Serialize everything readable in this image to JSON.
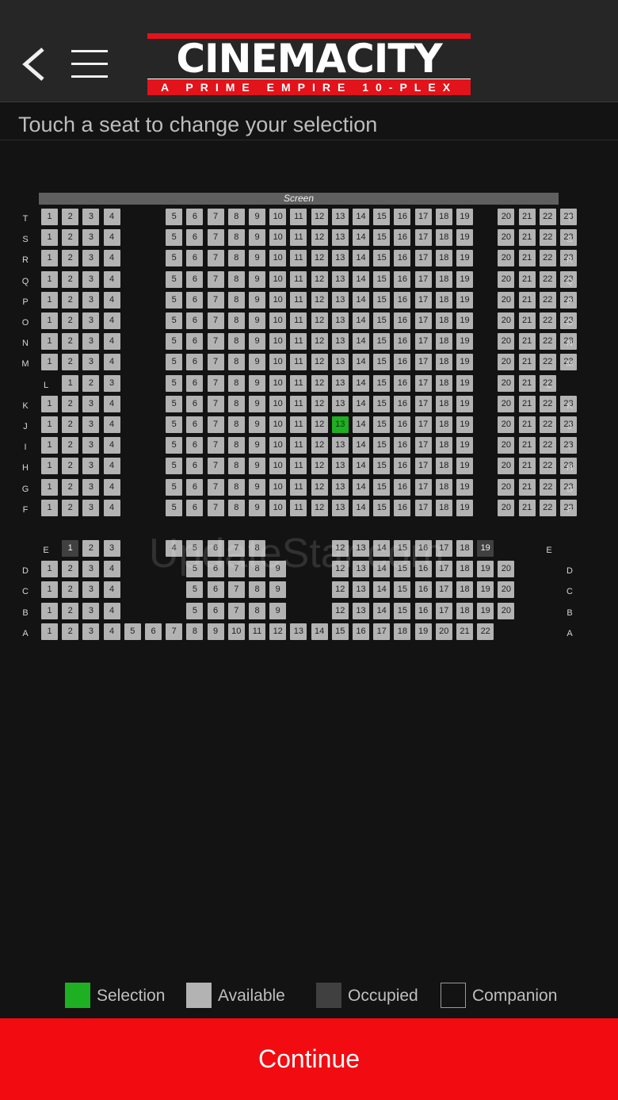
{
  "header": {
    "brand_name": "CINEMACITY",
    "brand_tagline": "A PRIME EMPIRE 10-PLEX"
  },
  "instruction": "Touch a seat to change your selection",
  "screen_label": "Screen",
  "watermark": "UpdateStar.com",
  "colors": {
    "selection": "#1faf22",
    "available": "#b3b3b3",
    "occupied": "#404040",
    "continue": "#f20b10"
  },
  "seat_rows": [
    {
      "row": "T",
      "seats": [
        1,
        2,
        3,
        4,
        5,
        6,
        7,
        8,
        9,
        10,
        11,
        12,
        13,
        14,
        15,
        16,
        17,
        18,
        19,
        20,
        21,
        22,
        23
      ]
    },
    {
      "row": "S",
      "seats": [
        1,
        2,
        3,
        4,
        5,
        6,
        7,
        8,
        9,
        10,
        11,
        12,
        13,
        14,
        15,
        16,
        17,
        18,
        19,
        20,
        21,
        22,
        23
      ]
    },
    {
      "row": "R",
      "seats": [
        1,
        2,
        3,
        4,
        5,
        6,
        7,
        8,
        9,
        10,
        11,
        12,
        13,
        14,
        15,
        16,
        17,
        18,
        19,
        20,
        21,
        22,
        23
      ]
    },
    {
      "row": "Q",
      "seats": [
        1,
        2,
        3,
        4,
        5,
        6,
        7,
        8,
        9,
        10,
        11,
        12,
        13,
        14,
        15,
        16,
        17,
        18,
        19,
        20,
        21,
        22,
        23
      ]
    },
    {
      "row": "P",
      "seats": [
        1,
        2,
        3,
        4,
        5,
        6,
        7,
        8,
        9,
        10,
        11,
        12,
        13,
        14,
        15,
        16,
        17,
        18,
        19,
        20,
        21,
        22,
        23
      ]
    },
    {
      "row": "O",
      "seats": [
        1,
        2,
        3,
        4,
        5,
        6,
        7,
        8,
        9,
        10,
        11,
        12,
        13,
        14,
        15,
        16,
        17,
        18,
        19,
        20,
        21,
        22,
        23
      ]
    },
    {
      "row": "N",
      "seats": [
        1,
        2,
        3,
        4,
        5,
        6,
        7,
        8,
        9,
        10,
        11,
        12,
        13,
        14,
        15,
        16,
        17,
        18,
        19,
        20,
        21,
        22,
        23
      ]
    },
    {
      "row": "M",
      "seats": [
        1,
        2,
        3,
        4,
        5,
        6,
        7,
        8,
        9,
        10,
        11,
        12,
        13,
        14,
        15,
        16,
        17,
        18,
        19,
        20,
        21,
        22,
        23
      ]
    },
    {
      "row": "L",
      "seats": [
        1,
        2,
        3,
        5,
        6,
        7,
        8,
        9,
        10,
        11,
        12,
        13,
        14,
        15,
        16,
        17,
        18,
        19,
        20,
        21,
        22
      ]
    },
    {
      "row": "K",
      "seats": [
        1,
        2,
        3,
        4,
        5,
        6,
        7,
        8,
        9,
        10,
        11,
        12,
        13,
        14,
        15,
        16,
        17,
        18,
        19,
        20,
        21,
        22,
        23
      ]
    },
    {
      "row": "J",
      "seats": [
        1,
        2,
        3,
        4,
        5,
        6,
        7,
        8,
        9,
        10,
        11,
        12,
        13,
        14,
        15,
        16,
        17,
        18,
        19,
        20,
        21,
        22,
        23
      ],
      "selected": [
        13
      ]
    },
    {
      "row": "I",
      "seats": [
        1,
        2,
        3,
        4,
        5,
        6,
        7,
        8,
        9,
        10,
        11,
        12,
        13,
        14,
        15,
        16,
        17,
        18,
        19,
        20,
        21,
        22,
        23
      ]
    },
    {
      "row": "H",
      "seats": [
        1,
        2,
        3,
        4,
        5,
        6,
        7,
        8,
        9,
        10,
        11,
        12,
        13,
        14,
        15,
        16,
        17,
        18,
        19,
        20,
        21,
        22,
        23
      ]
    },
    {
      "row": "G",
      "seats": [
        1,
        2,
        3,
        4,
        5,
        6,
        7,
        8,
        9,
        10,
        11,
        12,
        13,
        14,
        15,
        16,
        17,
        18,
        19,
        20,
        21,
        22,
        23
      ]
    },
    {
      "row": "F",
      "seats": [
        1,
        2,
        3,
        4,
        5,
        6,
        7,
        8,
        9,
        10,
        11,
        12,
        13,
        14,
        15,
        16,
        17,
        18,
        19,
        20,
        21,
        22,
        23
      ]
    },
    {
      "row": "E",
      "seats": [
        1,
        2,
        3,
        4,
        5,
        6,
        7,
        8,
        12,
        13,
        14,
        15,
        16,
        17,
        18,
        19
      ],
      "occupied": [
        1,
        19
      ]
    },
    {
      "row": "D",
      "seats": [
        1,
        2,
        3,
        4,
        5,
        6,
        7,
        8,
        9,
        12,
        13,
        14,
        15,
        16,
        17,
        18,
        19,
        20
      ]
    },
    {
      "row": "C",
      "seats": [
        1,
        2,
        3,
        4,
        5,
        6,
        7,
        8,
        9,
        12,
        13,
        14,
        15,
        16,
        17,
        18,
        19,
        20
      ]
    },
    {
      "row": "B",
      "seats": [
        1,
        2,
        3,
        4,
        5,
        6,
        7,
        8,
        9,
        12,
        13,
        14,
        15,
        16,
        17,
        18,
        19,
        20
      ]
    },
    {
      "row": "A",
      "seats": [
        1,
        2,
        3,
        4,
        5,
        6,
        7,
        8,
        9,
        10,
        11,
        12,
        13,
        14,
        15,
        16,
        17,
        18,
        19,
        20,
        21,
        22
      ]
    }
  ],
  "legend": {
    "selection": "Selection",
    "available": "Available",
    "occupied": "Occupied",
    "companion": "Companion"
  },
  "continue_label": "Continue"
}
